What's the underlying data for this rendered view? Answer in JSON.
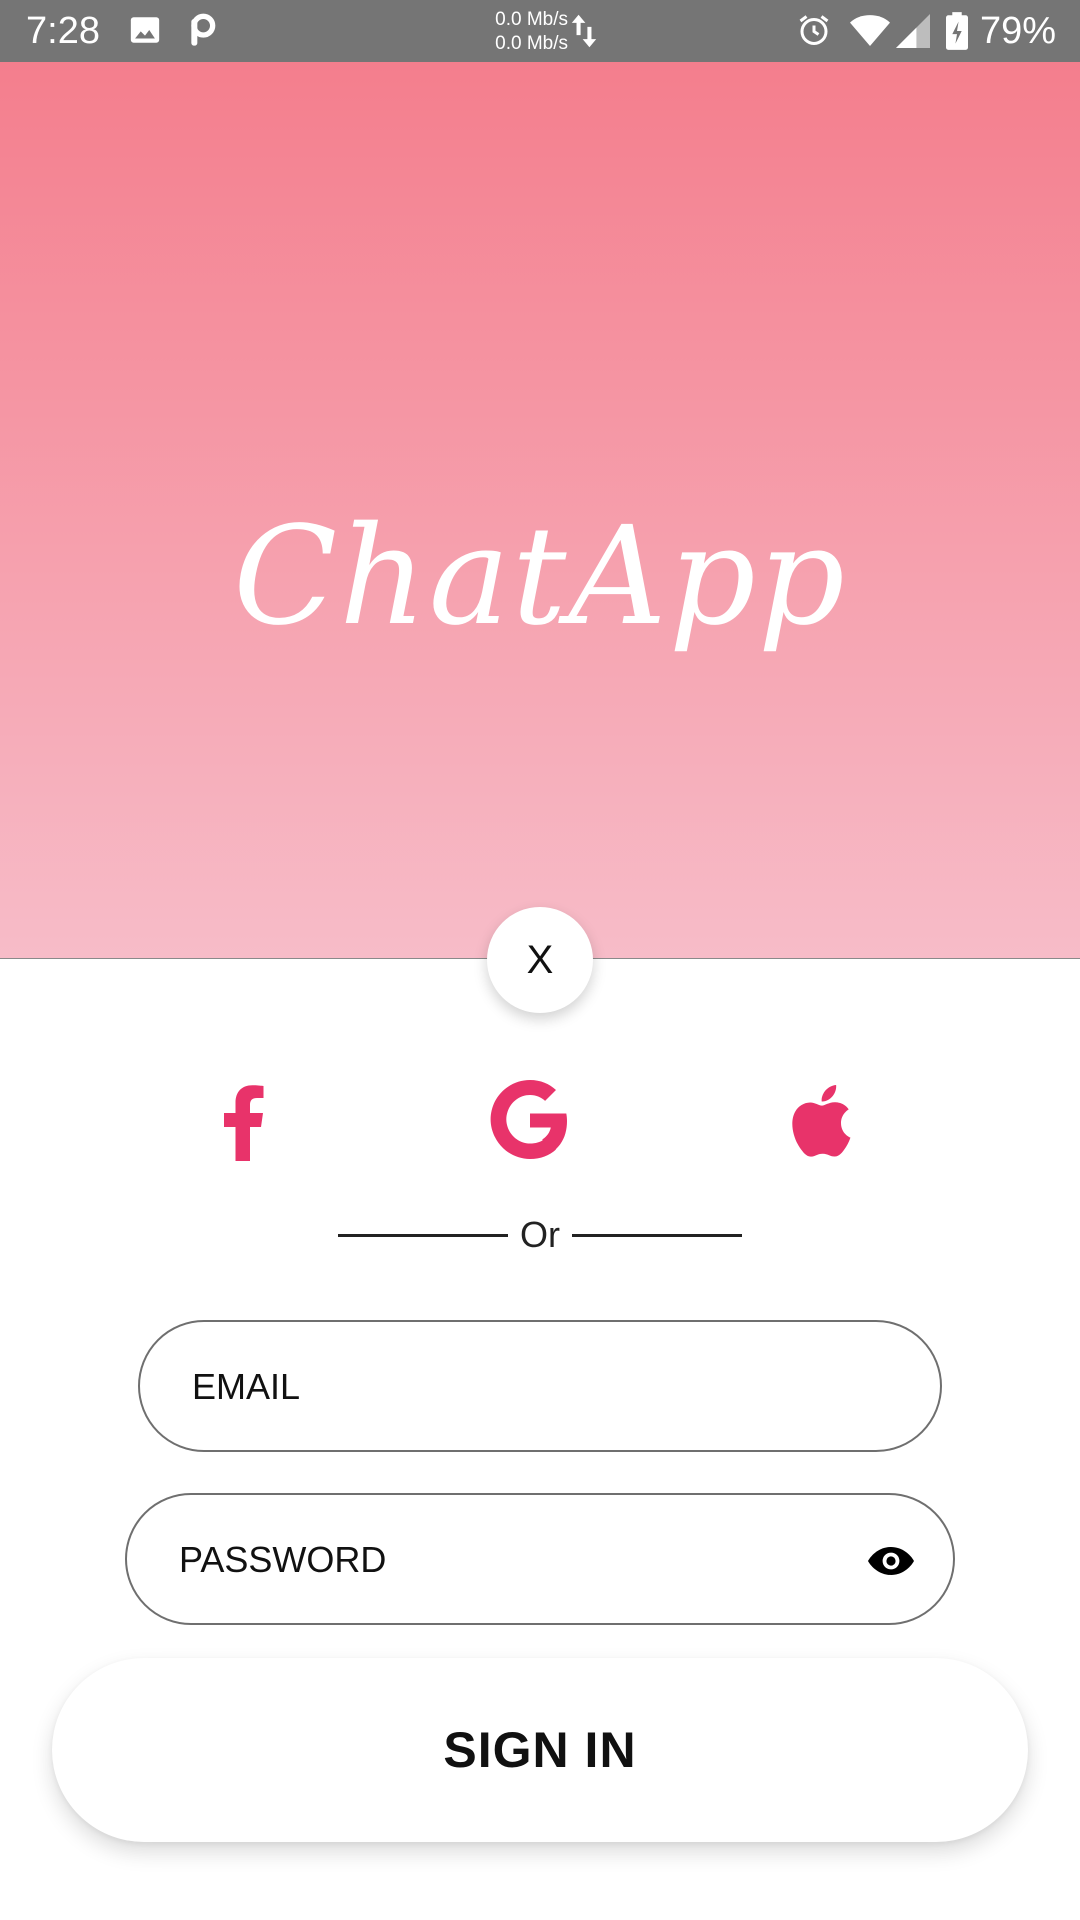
{
  "status_bar": {
    "time": "7:28",
    "net_up": "0.0 Mb/s",
    "net_down": "0.0 Mb/s",
    "battery": "79%",
    "icons": [
      "image-icon",
      "parking-app-icon",
      "data-arrows-icon",
      "alarm-icon",
      "wifi-icon",
      "cell-signal-icon",
      "battery-charging-icon"
    ]
  },
  "header": {
    "title": "ChatApp",
    "gradient_top": "#f47e8d",
    "gradient_bottom": "#f7bcc8"
  },
  "close_button": {
    "label": "X"
  },
  "social": {
    "accent": "#e8336a",
    "items": [
      "facebook-icon",
      "google-icon",
      "apple-icon"
    ]
  },
  "divider": {
    "label": "Or"
  },
  "form": {
    "email_placeholder": "EMAIL",
    "password_placeholder": "PASSWORD",
    "password_toggle_icon": "eye-icon",
    "submit_label": "SIGN IN"
  }
}
